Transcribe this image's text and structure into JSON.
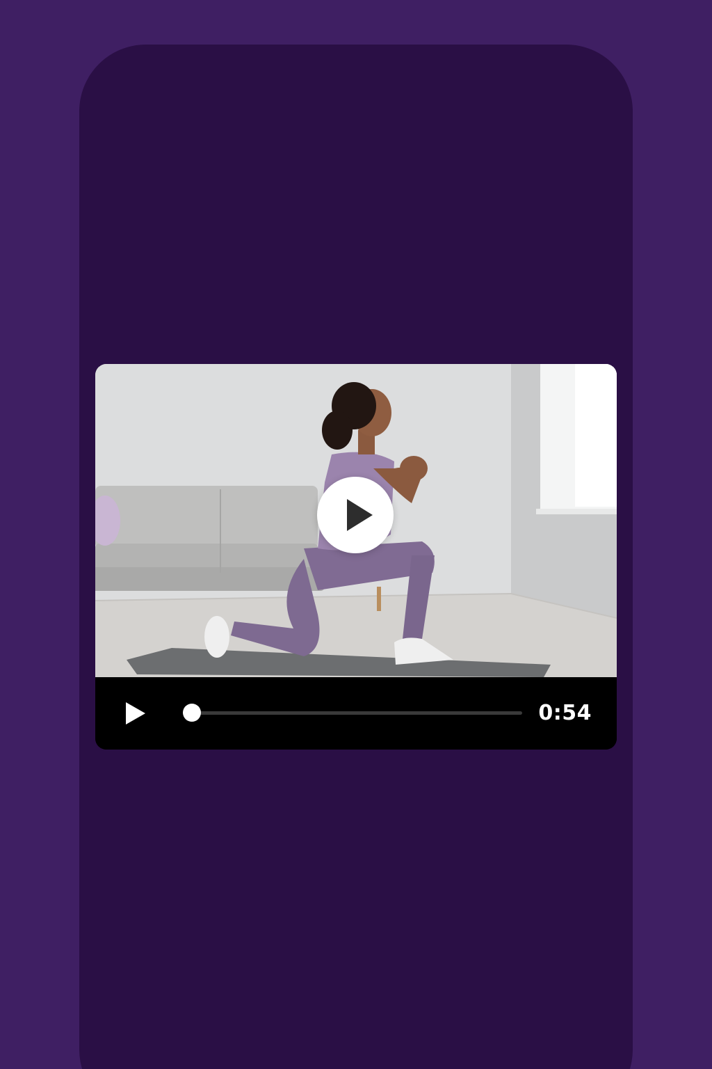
{
  "colors": {
    "page_background": "#3f1f63",
    "phone_background": "#2a0f45",
    "controls_background": "#000000",
    "scrubber_track": "#3a3a3a",
    "accent": "#ffffff"
  },
  "video": {
    "scene": "woman-lunge-exercise-on-yoga-mat",
    "big_play_icon": "play-icon",
    "current_time": "0:54",
    "progress": 0.0
  },
  "controls": {
    "play_icon": "play-icon"
  }
}
